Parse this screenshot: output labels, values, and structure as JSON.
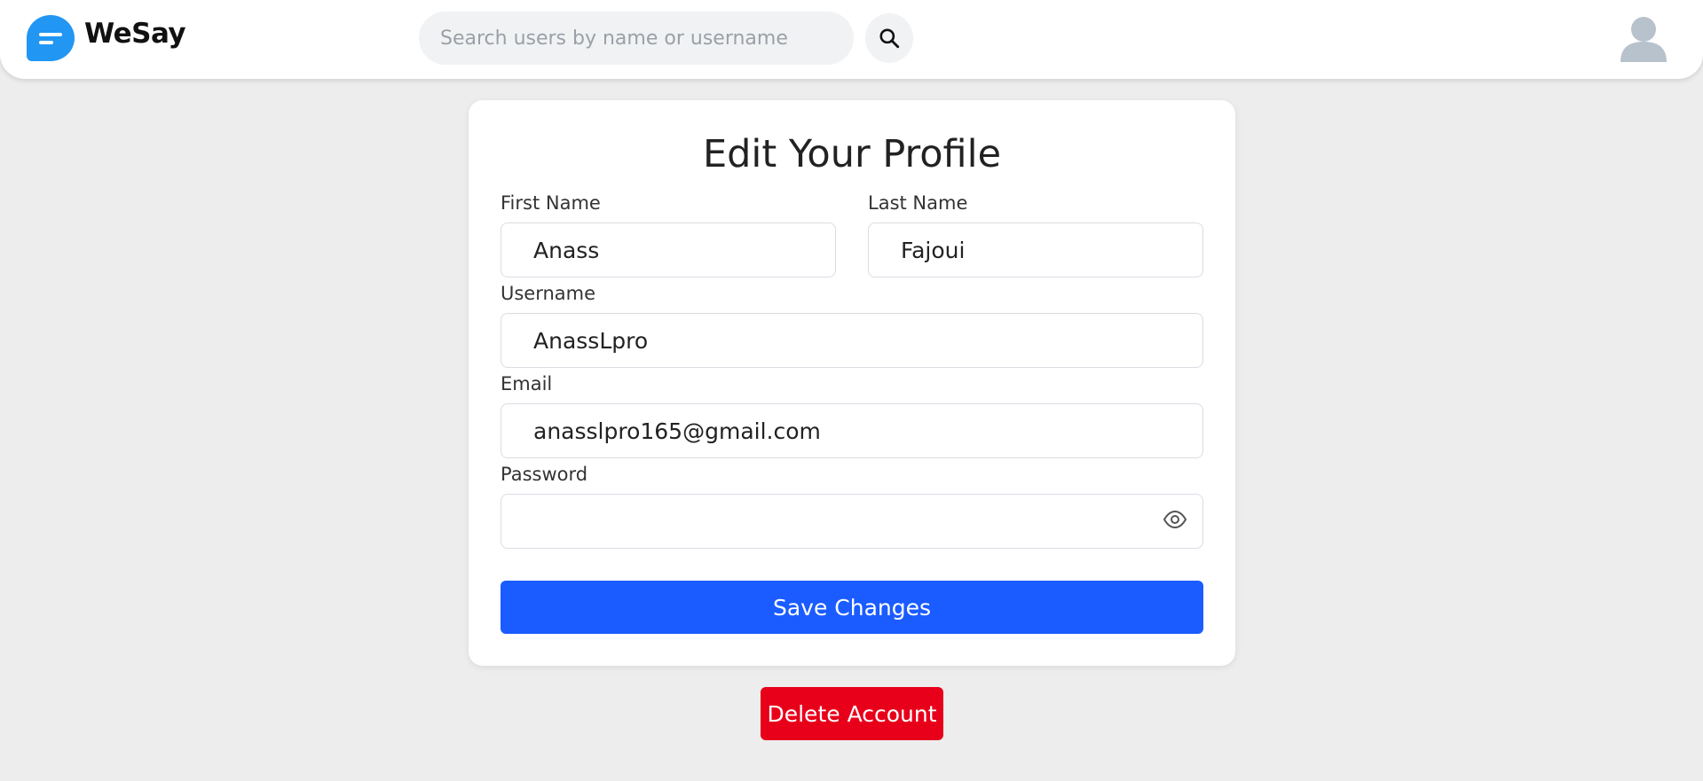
{
  "app": {
    "brand": "WeSay",
    "logo_icon": "chat-bubble-icon",
    "accent": "#2196f3"
  },
  "search": {
    "placeholder": "Search users by name or username",
    "value": "",
    "icon": "search-icon"
  },
  "user_menu": {
    "icon": "user-avatar-icon"
  },
  "profile_form": {
    "title": "Edit Your Profile",
    "first_name": {
      "label": "First Name",
      "value": "Anass"
    },
    "last_name": {
      "label": "Last Name",
      "value": "Fajoui"
    },
    "username": {
      "label": "Username",
      "value": "AnassLpro"
    },
    "email": {
      "label": "Email",
      "value": "anasslpro165@gmail.com"
    },
    "password": {
      "label": "Password",
      "value": "",
      "toggle_icon": "eye-icon"
    },
    "save_label": "Save Changes",
    "save_color": "#1a5cff"
  },
  "delete_label": "Delete Account",
  "delete_color": "#e8001a"
}
